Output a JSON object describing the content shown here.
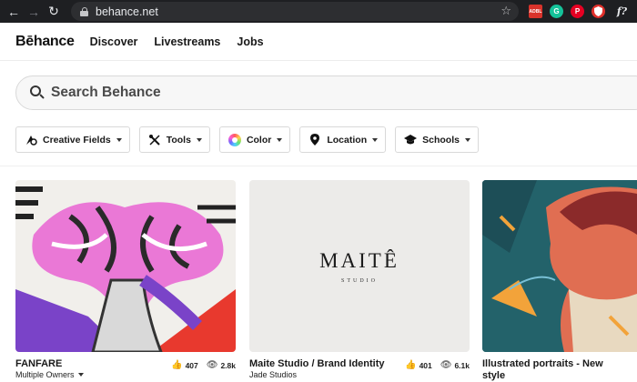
{
  "browser": {
    "url": "behance.net",
    "icons": [
      "back-arrow-icon",
      "forward-arrow-icon",
      "reload-icon",
      "lock-icon",
      "bookmark-star-icon"
    ],
    "extensions": [
      {
        "name": "adblock-extension-icon",
        "color": "#d8332b"
      },
      {
        "name": "grammarly-extension-icon",
        "color": "#15c39a",
        "glyph": "G"
      },
      {
        "name": "pinterest-extension-icon",
        "color": "#e60023",
        "glyph": "P"
      },
      {
        "name": "shield-extension-icon",
        "color": "#e0302b"
      },
      {
        "name": "font-extension-icon",
        "glyph": "f?"
      }
    ]
  },
  "header": {
    "logo": "Bēhance",
    "nav": [
      "Discover",
      "Livestreams",
      "Jobs"
    ]
  },
  "search": {
    "placeholder": "Search Behance"
  },
  "filters": [
    {
      "label": "Creative Fields",
      "icon": "creative-fields-icon"
    },
    {
      "label": "Tools",
      "icon": "tools-icon"
    },
    {
      "label": "Color",
      "icon": "color-wheel-icon"
    },
    {
      "label": "Location",
      "icon": "location-pin-icon"
    },
    {
      "label": "Schools",
      "icon": "graduation-cap-icon"
    }
  ],
  "projects": [
    {
      "title": "FANFARE",
      "owner": "Multiple Owners",
      "likes": "407",
      "views": "2.8k"
    },
    {
      "title": "Maite Studio / Brand Identity",
      "owner": "Jade Studios",
      "likes": "401",
      "views": "6.1k",
      "cover_word": "MAITÊ",
      "cover_sub": "STUDIO"
    },
    {
      "title": "Illustrated portraits - New",
      "title_line2": "style"
    }
  ],
  "colors": {
    "brand": "#191919",
    "chrome_bg": "#1e1f22",
    "portrait_teal": "#23626a"
  }
}
